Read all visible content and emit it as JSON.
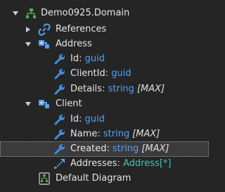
{
  "tree": {
    "root": {
      "label": "Demo0925.Domain",
      "icon": "domain-package-icon"
    },
    "references": {
      "label": "References",
      "icon": "link-icon"
    },
    "classes": [
      {
        "label": "Address",
        "icon": "class-icon",
        "attributes": [
          {
            "name": "Id",
            "type": "guid",
            "mult": ""
          },
          {
            "name": "ClientId",
            "type": "guid",
            "mult": ""
          },
          {
            "name": "Details",
            "type": "string",
            "mult": "[MAX]"
          }
        ]
      },
      {
        "label": "Client",
        "icon": "class-icon",
        "attributes": [
          {
            "name": "Id",
            "type": "guid",
            "mult": ""
          },
          {
            "name": "Name",
            "type": "string",
            "mult": "[MAX]"
          },
          {
            "name": "Created",
            "type": "string",
            "mult": "[MAX]"
          }
        ],
        "association": {
          "name": "Addresses",
          "type": "Address[*]"
        }
      }
    ],
    "diagram": {
      "label": "Default Diagram",
      "icon": "diagram-icon"
    },
    "colon": ":"
  },
  "colors": {
    "background": "#252526",
    "type_text": "#4fa3f7",
    "association_type_text": "#45c3b0",
    "wrench_icon": "#3f8ee0",
    "selected_row": "#3b3b3b"
  }
}
